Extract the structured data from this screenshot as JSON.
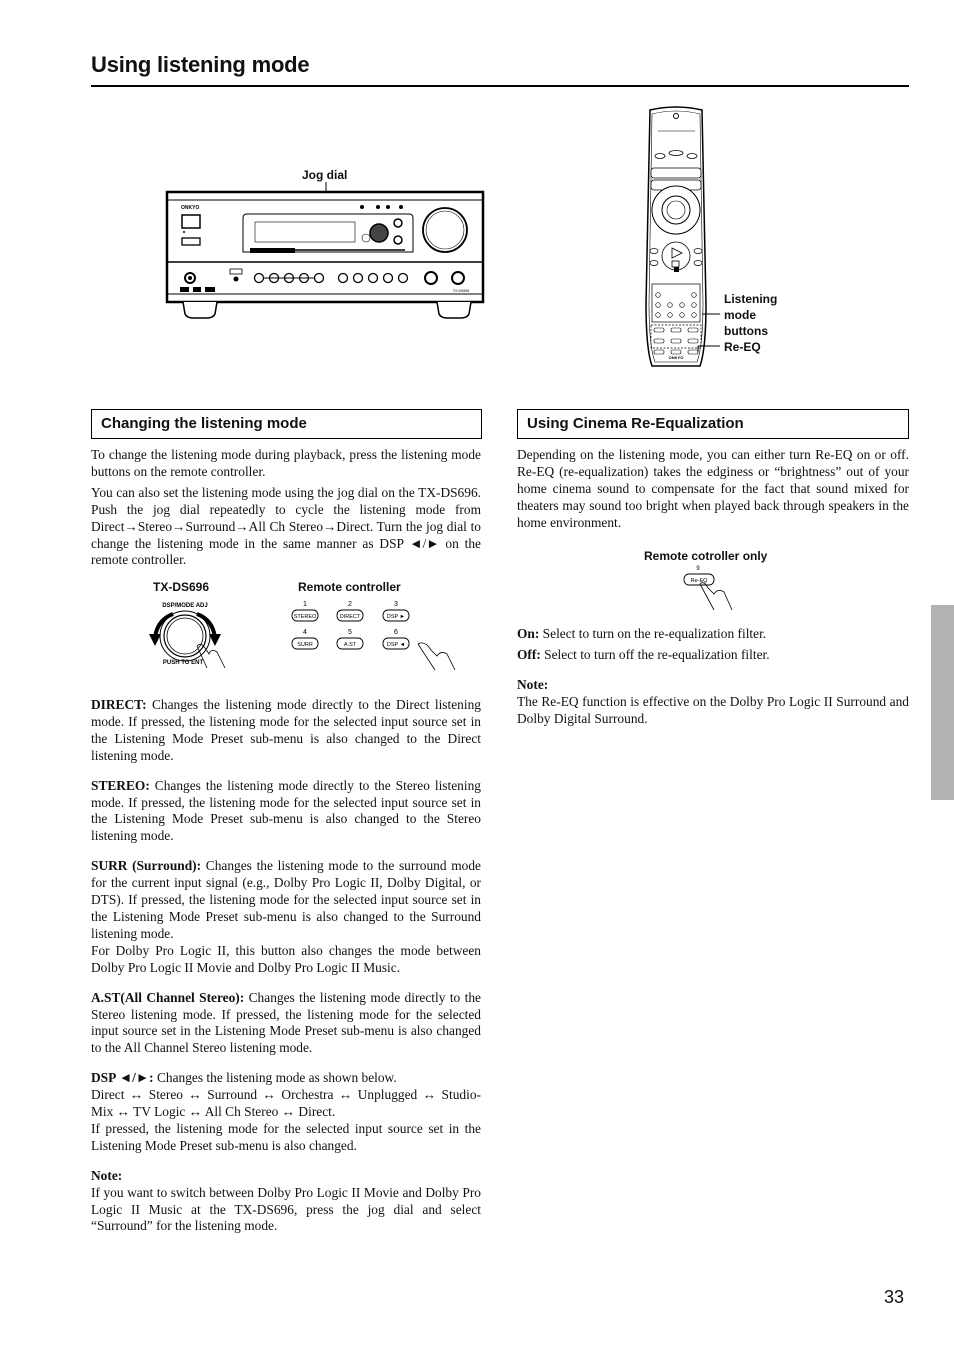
{
  "page": {
    "title": "Using listening mode",
    "page_number": "33"
  },
  "figures": {
    "receiver": {
      "label_jog_dial": "Jog dial",
      "brand": "ONKYO",
      "model": "TX-DS696"
    },
    "remote": {
      "label_listening_mode_1": "Listening",
      "label_listening_mode_2": "mode",
      "label_listening_mode_3": "buttons",
      "label_re_eq": "Re-EQ",
      "brand": "ONKYO"
    },
    "jog_detail": {
      "label_unit": "TX-DS696",
      "label_remote": "Remote controller",
      "dial_top_label": "DSP/MODE ADJ",
      "dial_bottom_label": "PUSH TO ENT",
      "buttons": [
        {
          "num": "1",
          "label": "STEREO"
        },
        {
          "num": "2",
          "label": "DIRECT"
        },
        {
          "num": "3",
          "label": "DSP ►"
        },
        {
          "num": "4",
          "label": "SURR"
        },
        {
          "num": "5",
          "label": "A.ST"
        },
        {
          "num": "6",
          "label": "DSP ◄"
        }
      ]
    },
    "reeq_detail": {
      "label": "Remote cotroller only",
      "num": "9",
      "button_label": "Re-EQ"
    }
  },
  "left_section": {
    "heading": "Changing the listening mode",
    "intro_1": "To change the listening mode during playback, press the listening mode buttons on the remote controller.",
    "intro_2": "You can also set the listening mode using the jog dial on the TX-DS696. Push the jog dial repeatedly to cycle the listening mode from Direct→Stereo→Surround→All Ch Stereo→Direct. Turn the jog dial to change the listening mode in the same manner as DSP ◄/► on the remote controller.",
    "items": [
      {
        "term": "DIRECT:",
        "text": " Changes the listening mode directly to the Direct listening mode. If pressed, the listening mode for the selected input source set in the Listening Mode Preset sub-menu is also changed to the Direct listening mode."
      },
      {
        "term": "STEREO:",
        "text": " Changes the listening mode directly to the Stereo listening mode. If pressed, the listening mode for the selected input source set in the Listening Mode Preset sub-menu is also changed to the Stereo listening mode."
      },
      {
        "term": "SURR (Surround):",
        "text": " Changes the listening mode to the surround mode for the current input signal (e.g., Dolby Pro Logic II, Dolby Digital, or DTS). If pressed, the listening mode for the selected input source set in the Listening Mode Preset sub-menu is also changed to the Surround listening mode.",
        "extra": "For Dolby Pro Logic II, this button also changes the mode between Dolby Pro Logic II Movie and Dolby Pro Logic II Music."
      },
      {
        "term": "A.ST(All Channel Stereo):",
        "text": " Changes the listening mode directly to the Stereo listening mode. If pressed, the listening mode for the selected input source set in the Listening Mode Preset sub-menu is also changed to the All Channel Stereo listening mode."
      },
      {
        "term": "DSP ◄/►:",
        "text": " Changes the listening mode as shown below.",
        "sequence": "Direct ↔ Stereo ↔ Surround ↔ Orchestra ↔ Unplugged ↔ Studio-Mix ↔ TV Logic ↔ All Ch Stereo ↔ Direct.",
        "extra": "If pressed, the listening mode for the selected input source set in the Listening Mode Preset sub-menu is also changed."
      }
    ],
    "note_label": "Note:",
    "note_text": "If you want to switch between Dolby Pro Logic II Movie and Dolby Pro Logic II Music at the TX-DS696, press the jog dial and select “Surround” for the listening mode."
  },
  "right_section": {
    "heading": "Using Cinema Re-Equalization",
    "intro": "Depending on the listening mode, you can either turn Re-EQ on or off. Re-EQ (re-equalization) takes the edginess or “brightness” out of your home cinema sound to compensate for the fact that sound mixed for theaters may sound too bright when played back through speakers in the home environment.",
    "on_term": "On:",
    "on_text": " Select to turn on the re-equalization filter.",
    "off_term": "Off:",
    "off_text": " Select to turn off the re-equalization filter.",
    "note_label": "Note:",
    "note_text": "The Re-EQ function is effective on the Dolby Pro Logic II Surround and Dolby Digital Surround."
  }
}
